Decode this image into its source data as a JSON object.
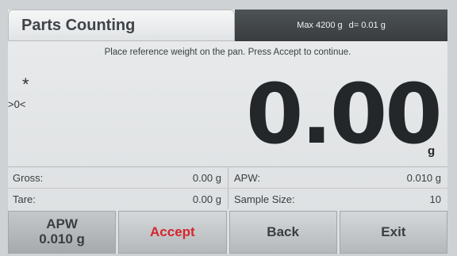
{
  "header": {
    "title": "Parts Counting",
    "max_capacity": "Max 4200 g",
    "readability": "d= 0.01 g"
  },
  "instruction": "Place reference weight on the pan. Press Accept to continue.",
  "indicators": {
    "stable": "*",
    "center_of_zero": ">0<"
  },
  "display": {
    "value": "0.00",
    "unit": "g"
  },
  "info": {
    "gross_label": "Gross:",
    "gross_value": "0.00 g",
    "tare_label": "Tare:",
    "tare_value": "0.00 g",
    "apw_label": "APW:",
    "apw_value": "0.010 g",
    "sample_label": "Sample Size:",
    "sample_value": "10"
  },
  "buttons": {
    "apw_title": "APW",
    "apw_value": "0.010 g",
    "accept": "Accept",
    "back": "Back",
    "exit": "Exit"
  },
  "colors": {
    "accept_text": "#d4262c",
    "capacity_bar": "#3c4043"
  }
}
